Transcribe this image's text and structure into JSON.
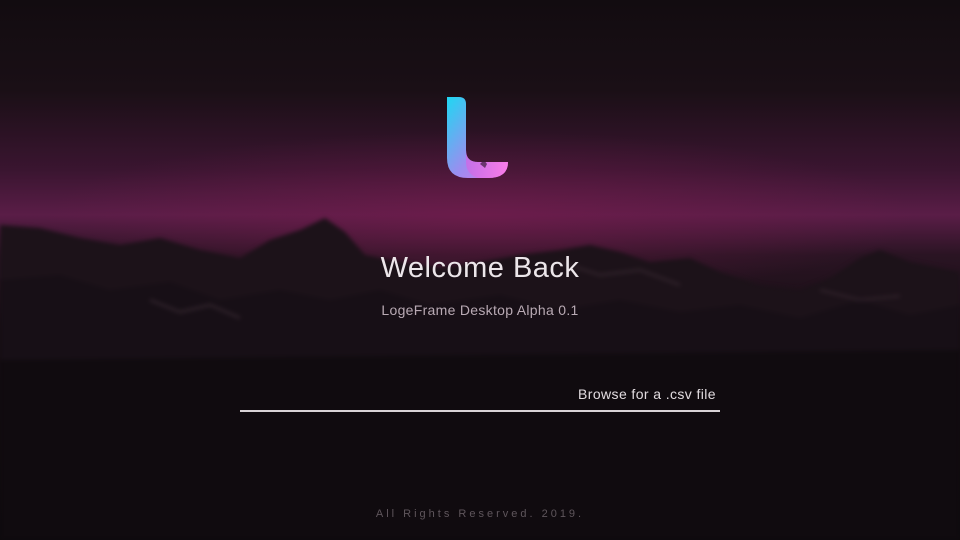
{
  "colors": {
    "sky_accent": "#5a1d47",
    "logo_gradient_start": "#1fd7f2",
    "logo_gradient_end": "#e86ee8",
    "text_primary": "#ece6ea",
    "text_secondary": "#b9aab4",
    "underline": "#d9d3d7"
  },
  "welcome": {
    "title": "Welcome Back",
    "subtitle": "LogeFrame Desktop Alpha 0.1"
  },
  "file_picker": {
    "label": "Browse for a .csv file"
  },
  "footer": {
    "text": "All Rights Reserved. 2019."
  },
  "logo": {
    "icon": "logeframe-logo-icon"
  }
}
